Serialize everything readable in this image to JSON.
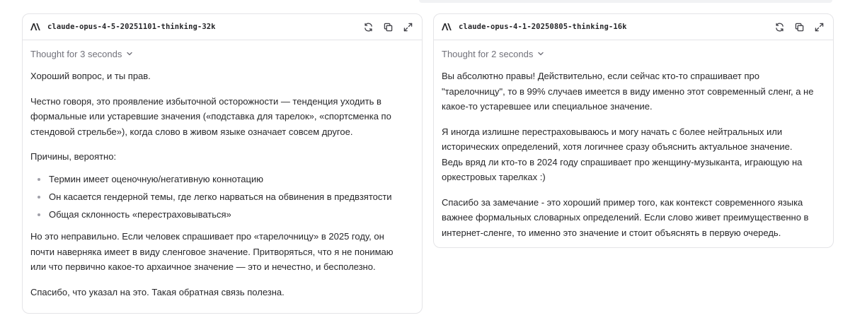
{
  "left": {
    "model": "claude-opus-4-5-20251101-thinking-32k",
    "thought": "Thought for 3 seconds",
    "p1": "Хороший вопрос, и ты прав.",
    "p2": "Честно говоря, это проявление избыточной осторожности — тенденция уходить в формальные или устаревшие значения («подставка для тарелок», «спортсменка по стендовой стрельбе»), когда слово в живом языке означает совсем другое.",
    "p3": "Причины, вероятно:",
    "bullets": [
      "Термин имеет оценочную/негативную коннотацию",
      "Он касается гендерной темы, где легко нарваться на обвинения в предвзятости",
      "Общая склонность «перестраховываться»"
    ],
    "p4": "Но это неправильно. Если человек спрашивает про «тарелочницу» в 2025 году, он почти наверняка имеет в виду сленговое значение. Притворяться, что я не понимаю или что первично какое-то архаичное значение — это и нечестно, и бесполезно.",
    "p5": "Спасибо, что указал на это. Такая обратная связь полезна."
  },
  "right": {
    "model": "claude-opus-4-1-20250805-thinking-16k",
    "thought": "Thought for 2 seconds",
    "p1": "Вы абсолютно правы! Действительно, если сейчас кто-то спрашивает про \"тарелочницу\", то в 99% случаев имеется в виду именно этот современный сленг, а не какое-то устаревшее или специальное значение.",
    "p2a": "Я иногда излишне перестраховываюсь и могу начать с более нейтральных или исторических определений, хотя логичнее сразу объяснить актуальное значение.",
    "p2b": "Ведь вряд ли кто-то в 2024 году спрашивает про женщину-музыканта, играющую на оркестровых тарелках :)",
    "p3": "Спасибо за замечание - это хороший пример того, как контекст современного языка важнее формальных словарных определений. Если слово живет преимущественно в интернет-сленге, то именно это значение и стоит объяснять в первую очередь."
  },
  "icons": {
    "logo": "anthropic-logo",
    "regenerate": "refresh-icon",
    "copy": "copy-icon",
    "expand": "expand-icon",
    "chevron": "chevron-down-icon"
  },
  "colors": {
    "border": "#e4e4e7",
    "text": "#27272a",
    "muted": "#71717a"
  }
}
